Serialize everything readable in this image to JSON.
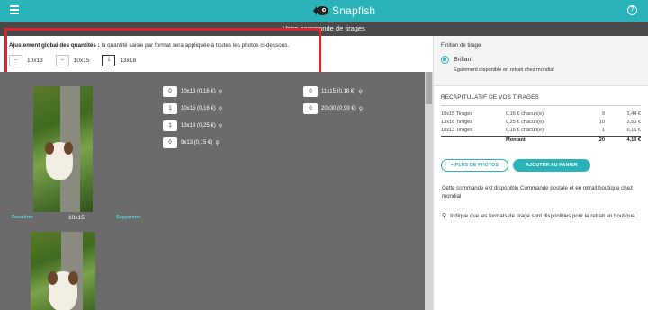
{
  "header": {
    "logo_text": "Snapfish",
    "subtitle": "Votre commande de tirages"
  },
  "adjust": {
    "title_bold": "Ajustement global des quantités :",
    "title_rest": " la quantité saisie par format sera appliquée à toutes les photos ci-dessous.",
    "formats": [
      {
        "value": "--",
        "label": "10x13"
      },
      {
        "value": "--",
        "label": "10x15"
      },
      {
        "value": "1",
        "label": "13x18"
      }
    ]
  },
  "photo1": {
    "format": "10x15",
    "recadrer": "Recadrer",
    "supprimer": "Supprimer",
    "left_formats": [
      {
        "qty": "0",
        "label": "10x13 (0,16 €)"
      },
      {
        "qty": "1",
        "label": "10x15 (0,16 €)"
      },
      {
        "qty": "1",
        "label": "13x18 (0,25 €)"
      },
      {
        "qty": "0",
        "label": "9x13 (0,15 €)"
      }
    ],
    "right_formats": [
      {
        "qty": "0",
        "label": "11x15 (0,18 €)"
      },
      {
        "qty": "0",
        "label": "20x30 (0,99 €)"
      }
    ]
  },
  "right": {
    "finition_title": "Finition de tirage",
    "finition_option": "Brillant",
    "finition_note": "Egalement disponible en retrait chez mondial",
    "recap_title": "RECAPITULATIF DE VOS TIRAGES",
    "recap_rows": [
      {
        "label": "10x15 Tirages",
        "price": "0,16 € chacun(e)",
        "qty": "9",
        "total": "1,44 €"
      },
      {
        "label": "13x18 Tirages",
        "price": "0,25 € chacun(e)",
        "qty": "10",
        "total": "2,50 €"
      },
      {
        "label": "10x13 Tirages",
        "price": "0,16 € chacun(e)",
        "qty": "1",
        "total": "0,16 €"
      }
    ],
    "recap_total": {
      "label": "Montant",
      "qty": "20",
      "total": "4,10 €"
    },
    "btn_more": "+ PLUS DE PHOTOS",
    "btn_cart": "AJOUTER AU PANIER",
    "info_order": "Cette commande est disponible Commande postale et en retrait boutique chez mondial",
    "info_pin": "Indique que les formats de tirage sont disponibles pour le retrait en boutique."
  },
  "icons": {
    "menu": "menu-icon",
    "help": "help-icon",
    "pin": "location-pin-icon",
    "logo": "fish-logo-icon"
  },
  "colors": {
    "brand": "#2ab3b8",
    "highlight": "#e0242a",
    "link": "#5fd3d8"
  }
}
